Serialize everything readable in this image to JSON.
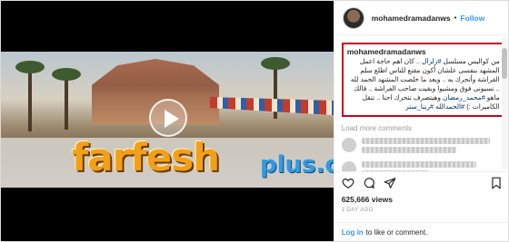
{
  "post": {
    "username": "mohamedramadanws",
    "follow_label": "Follow",
    "separator": "•",
    "caption": {
      "user": "mohamedramadanws",
      "line1": "من كواليس مسلسل ",
      "hashtag1": "#زلزال",
      "line2": ".. كان اهم حاجة اعمل المشهد بنفسى علشان أكون مقنع للناس اطلع سلم الفراشة وأتحرك به .. ويعد ما خلصت المشهد الحمد لله .. نسيونى فوق ومشيوا وبقيت صاحب الفراشة .. قالك ماهو ",
      "hashtag2": "#محمد_رمضان",
      "line3": " وهيتصرف نتحرك احنا .. تنقل الكاميرات :) ",
      "hashtag3": "#الحمدالله",
      "hashtag4": "#رينا_ستر"
    },
    "load_more": "Load more comments",
    "views": "625,666 views",
    "date": "1 DAY AGO",
    "login_link": "Log in",
    "login_text": "to like or comment."
  },
  "watermark": {
    "main": "farfesh",
    "plus": "plus.com"
  },
  "icons": {
    "like": "heart-icon",
    "comment": "comment-icon",
    "share": "share-icon",
    "save": "bookmark-icon",
    "play": "play-icon"
  },
  "colors": {
    "follow": "#3897f0",
    "highlight_border": "#d0021b",
    "watermark_orange": "#f3a018",
    "watermark_blue": "#2f9be3"
  }
}
